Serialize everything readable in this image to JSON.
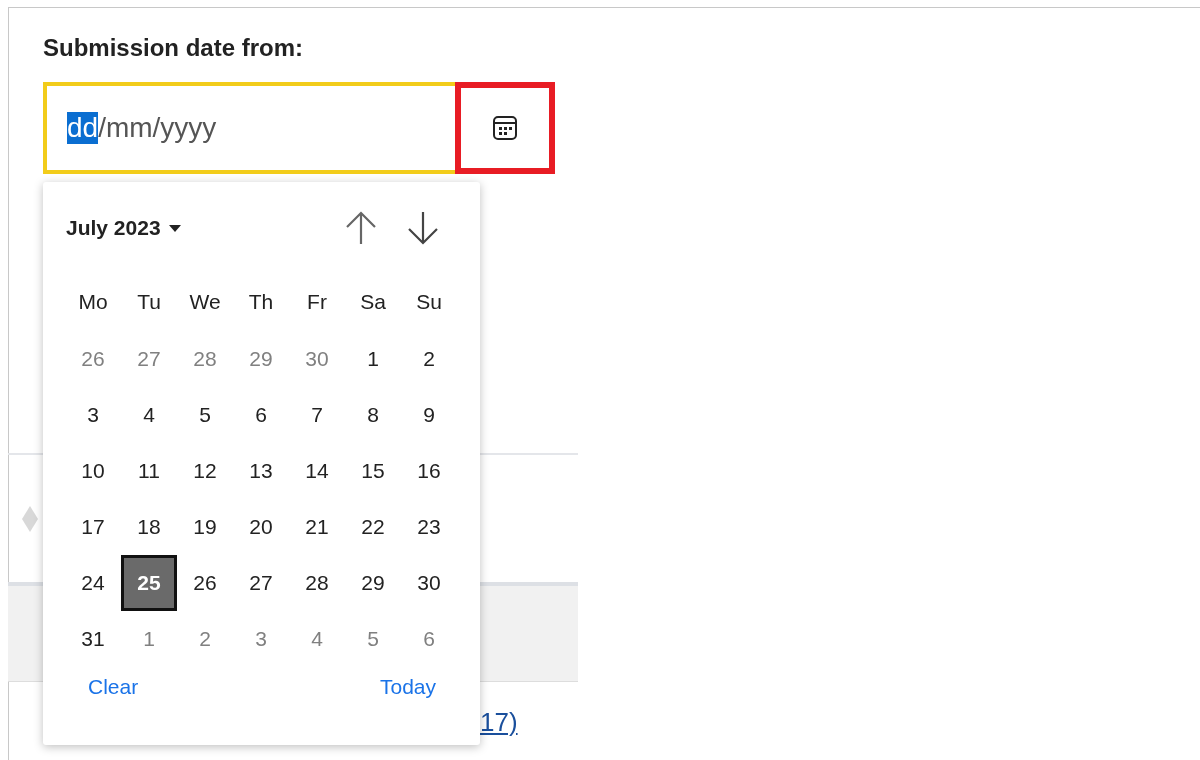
{
  "form": {
    "label": "Submission date from:",
    "date_field": {
      "focused": true,
      "segments": [
        {
          "text": "dd",
          "selected": true
        },
        {
          "text": "/mm/yyyy",
          "selected": false
        }
      ]
    },
    "calendar_button": {
      "highlighted": true
    }
  },
  "background": {
    "link": "17)"
  },
  "date_picker": {
    "month_label": "July 2023",
    "weekdays": [
      "Mo",
      "Tu",
      "We",
      "Th",
      "Fr",
      "Sa",
      "Su"
    ],
    "weeks": [
      [
        {
          "day": "26",
          "outside": true,
          "selected": false
        },
        {
          "day": "27",
          "outside": true,
          "selected": false
        },
        {
          "day": "28",
          "outside": true,
          "selected": false
        },
        {
          "day": "29",
          "outside": true,
          "selected": false
        },
        {
          "day": "30",
          "outside": true,
          "selected": false
        },
        {
          "day": "1",
          "outside": false,
          "selected": false
        },
        {
          "day": "2",
          "outside": false,
          "selected": false
        }
      ],
      [
        {
          "day": "3",
          "outside": false,
          "selected": false
        },
        {
          "day": "4",
          "outside": false,
          "selected": false
        },
        {
          "day": "5",
          "outside": false,
          "selected": false
        },
        {
          "day": "6",
          "outside": false,
          "selected": false
        },
        {
          "day": "7",
          "outside": false,
          "selected": false
        },
        {
          "day": "8",
          "outside": false,
          "selected": false
        },
        {
          "day": "9",
          "outside": false,
          "selected": false
        }
      ],
      [
        {
          "day": "10",
          "outside": false,
          "selected": false
        },
        {
          "day": "11",
          "outside": false,
          "selected": false
        },
        {
          "day": "12",
          "outside": false,
          "selected": false
        },
        {
          "day": "13",
          "outside": false,
          "selected": false
        },
        {
          "day": "14",
          "outside": false,
          "selected": false
        },
        {
          "day": "15",
          "outside": false,
          "selected": false
        },
        {
          "day": "16",
          "outside": false,
          "selected": false
        }
      ],
      [
        {
          "day": "17",
          "outside": false,
          "selected": false
        },
        {
          "day": "18",
          "outside": false,
          "selected": false
        },
        {
          "day": "19",
          "outside": false,
          "selected": false
        },
        {
          "day": "20",
          "outside": false,
          "selected": false
        },
        {
          "day": "21",
          "outside": false,
          "selected": false
        },
        {
          "day": "22",
          "outside": false,
          "selected": false
        },
        {
          "day": "23",
          "outside": false,
          "selected": false
        }
      ],
      [
        {
          "day": "24",
          "outside": false,
          "selected": false
        },
        {
          "day": "25",
          "outside": false,
          "selected": true
        },
        {
          "day": "26",
          "outside": false,
          "selected": false
        },
        {
          "day": "27",
          "outside": false,
          "selected": false
        },
        {
          "day": "28",
          "outside": false,
          "selected": false
        },
        {
          "day": "29",
          "outside": false,
          "selected": false
        },
        {
          "day": "30",
          "outside": false,
          "selected": false
        }
      ],
      [
        {
          "day": "31",
          "outside": false,
          "selected": false
        },
        {
          "day": "1",
          "outside": true,
          "selected": false
        },
        {
          "day": "2",
          "outside": true,
          "selected": false
        },
        {
          "day": "3",
          "outside": true,
          "selected": false
        },
        {
          "day": "4",
          "outside": true,
          "selected": false
        },
        {
          "day": "5",
          "outside": true,
          "selected": false
        },
        {
          "day": "6",
          "outside": true,
          "selected": false
        }
      ]
    ],
    "footer": {
      "clear": "Clear",
      "today": "Today"
    }
  }
}
